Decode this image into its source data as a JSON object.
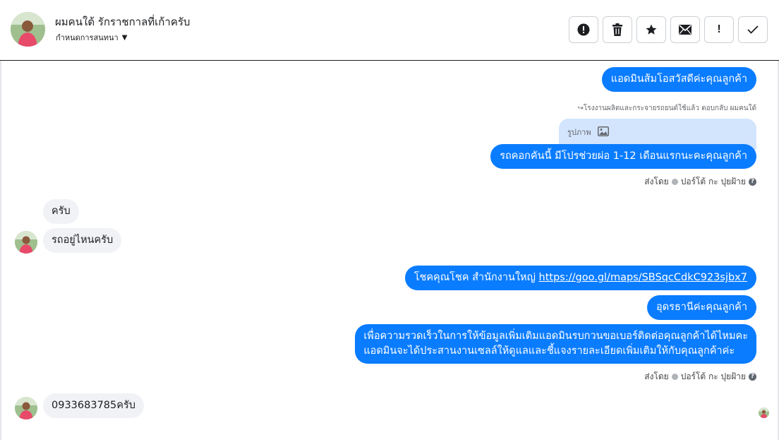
{
  "header": {
    "title": "ผมคนใต้ รักราชกาลที่เก้าครับ",
    "subtitle": "กำหนดการสนทนา",
    "actions": [
      {
        "name": "alert-icon"
      },
      {
        "name": "trash-icon"
      },
      {
        "name": "star-icon"
      },
      {
        "name": "mail-icon"
      },
      {
        "name": "exclamation-icon",
        "label": "!"
      },
      {
        "name": "check-icon"
      }
    ]
  },
  "messages": {
    "m1": "แอดมินส้มโอสวัสดีค่ะคุณลูกค้า",
    "reply_note": "↪โรงงานผลิตและกระจายรถยนต์ใช้แล้ว ตอบกลับ ผมคนใต้",
    "quoted_label": "รูปภาพ",
    "m2": "รถคอกคันนี้ มีโปรช่วยผ่อ 1-12 เดือนแรกนะคะคุณลูกค้า",
    "sent_by_1": "ส่งโดย",
    "sender_1": "ปอร์โต้ กะ ปุยฝ้าย",
    "in1": "ครับ",
    "in2": "รถอยู่ไหนครับ",
    "m3_text": "โชคคุณโชค สำนักงานใหญ่ ",
    "m3_link": "https://goo.gl/maps/SBSqcCdkC923sjbx7",
    "m4": "อุดรธานีค่ะคุณลูกค้า",
    "m5_line1": "เพื่อความรวดเร็วในการให้ข้อมูลเพิ่มเติมแอดมินรบกวนขอเบอร์ติดต่อคุณลูกค้าได้ไหมคะ",
    "m5_line2": "แอดมินจะได้ประสานงานเซลล์ให้ดูแลและชี้แจงรายละเอียดเพิ่มเติมให้กับคุณลูกค้าค่ะ",
    "sent_by_2": "ส่งโดย",
    "sender_2": "ปอร์โต้ กะ ปุยฝ้าย",
    "in3": "0933683785ครับ"
  },
  "colors": {
    "outgoing": "#0a7cff",
    "incoming": "#f0f2f5",
    "quoted": "#d3e4fd"
  }
}
